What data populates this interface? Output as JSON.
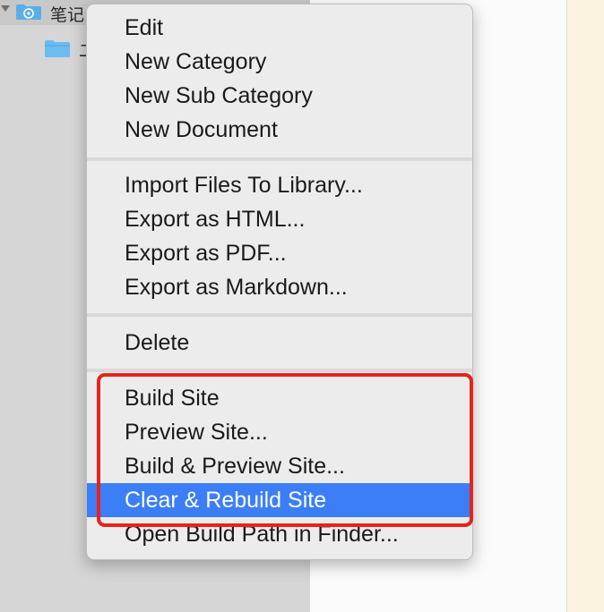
{
  "sidebar": {
    "root_item": {
      "label": "笔记",
      "icon": "library-icon",
      "expanded": true
    },
    "child_item": {
      "label": "二",
      "icon": "folder-icon"
    }
  },
  "context_menu": {
    "groups": [
      {
        "items": [
          {
            "label": "Edit"
          },
          {
            "label": "New Category"
          },
          {
            "label": "New Sub Category"
          },
          {
            "label": "New Document"
          }
        ]
      },
      {
        "items": [
          {
            "label": "Import Files To Library..."
          },
          {
            "label": "Export as HTML..."
          },
          {
            "label": "Export as PDF..."
          },
          {
            "label": "Export as Markdown..."
          }
        ]
      },
      {
        "items": [
          {
            "label": "Delete"
          }
        ]
      },
      {
        "items": [
          {
            "label": "Build Site"
          },
          {
            "label": "Preview Site..."
          },
          {
            "label": "Build & Preview Site..."
          },
          {
            "label": "Clear & Rebuild Site",
            "highlighted": true
          },
          {
            "label": "Open Build Path in Finder..."
          }
        ]
      }
    ]
  },
  "colors": {
    "highlight": "#3b7ef7",
    "annotation": "#e8231a",
    "preview_background": "#fbf3e0"
  }
}
